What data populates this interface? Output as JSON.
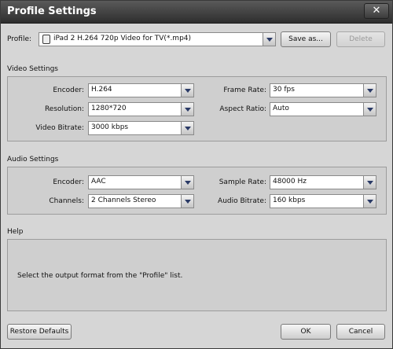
{
  "window": {
    "title": "Profile Settings",
    "close_label": "✕"
  },
  "profile": {
    "label": "Profile:",
    "value": "iPad 2 H.264 720p Video for TV(*.mp4)",
    "save_as": "Save as...",
    "delete": "Delete"
  },
  "video": {
    "title": "Video Settings",
    "encoder_label": "Encoder:",
    "encoder_value": "H.264",
    "resolution_label": "Resolution:",
    "resolution_value": "1280*720",
    "bitrate_label": "Video Bitrate:",
    "bitrate_value": "3000 kbps",
    "framerate_label": "Frame Rate:",
    "framerate_value": "30 fps",
    "aspect_label": "Aspect Ratio:",
    "aspect_value": "Auto"
  },
  "audio": {
    "title": "Audio Settings",
    "encoder_label": "Encoder:",
    "encoder_value": "AAC",
    "channels_label": "Channels:",
    "channels_value": "2 Channels Stereo",
    "samplerate_label": "Sample Rate:",
    "samplerate_value": "48000 Hz",
    "bitrate_label": "Audio Bitrate:",
    "bitrate_value": "160 kbps"
  },
  "help": {
    "title": "Help",
    "text": "Select the output format from the \"Profile\" list."
  },
  "footer": {
    "restore": "Restore Defaults",
    "ok": "OK",
    "cancel": "Cancel"
  },
  "icons": {
    "close": "close-icon",
    "combo_arrow": "chevron-down-icon",
    "profile": "device-icon"
  }
}
